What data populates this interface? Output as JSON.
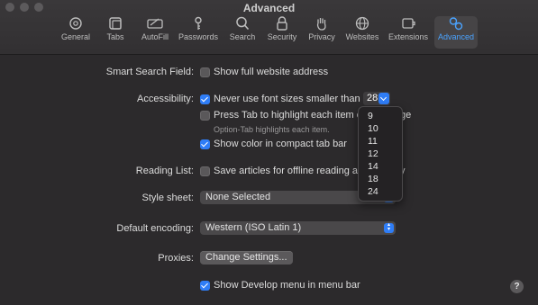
{
  "window": {
    "title": "Advanced"
  },
  "toolbar": {
    "items": [
      {
        "label": "General"
      },
      {
        "label": "Tabs"
      },
      {
        "label": "AutoFill"
      },
      {
        "label": "Passwords"
      },
      {
        "label": "Search"
      },
      {
        "label": "Security"
      },
      {
        "label": "Privacy"
      },
      {
        "label": "Websites"
      },
      {
        "label": "Extensions"
      },
      {
        "label": "Advanced",
        "active": true
      }
    ]
  },
  "smart_search": {
    "label": "Smart Search Field:",
    "option": "Show full website address",
    "checked": false
  },
  "accessibility": {
    "label": "Accessibility:",
    "font_option": "Never use font sizes smaller than",
    "font_checked": true,
    "font_size": "28",
    "tab_option": "Press Tab to highlight each item c",
    "tab_option_tail": "ge",
    "tab_checked": false,
    "tab_hint": "Option-Tab highlights each item.",
    "color_option": "Show color in compact tab bar",
    "color_checked": true
  },
  "font_size_menu": [
    "9",
    "10",
    "11",
    "12",
    "14",
    "18",
    "24"
  ],
  "reading_list": {
    "label": "Reading List:",
    "option": "Save articles for offline reading au",
    "option_tail": "y",
    "checked": false
  },
  "style_sheet": {
    "label": "Style sheet:",
    "value": "None Selected"
  },
  "default_encoding": {
    "label": "Default encoding:",
    "value": "Western (ISO Latin 1)"
  },
  "proxies": {
    "label": "Proxies:",
    "button": "Change Settings..."
  },
  "develop": {
    "option": "Show Develop menu in menu bar",
    "checked": true
  },
  "help": {
    "label": "?"
  },
  "colors": {
    "accent": "#2f7df6",
    "background": "#2c2a2c",
    "active_tab": "#4aa3ff"
  }
}
